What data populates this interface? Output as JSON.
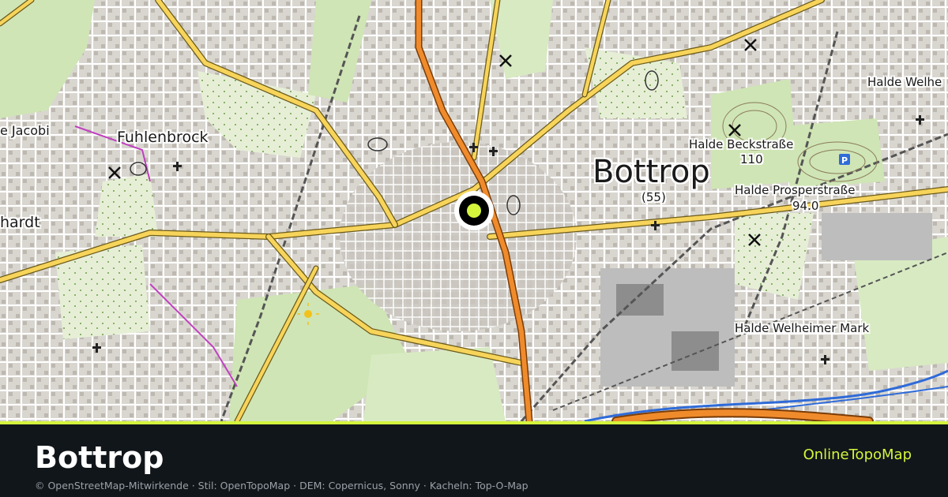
{
  "map": {
    "place_labels": [
      {
        "key": "bottrop",
        "text": "Bottrop"
      },
      {
        "key": "fuhlenbrock",
        "text": "Fuhlenbrock"
      },
      {
        "key": "jacobi",
        "text": "e Jacobi"
      },
      {
        "key": "hardt",
        "text": "hardt"
      },
      {
        "key": "halde_beckstrasse",
        "text": "Halde Beckstraße"
      },
      {
        "key": "beck_elev",
        "text": "110"
      },
      {
        "key": "halde_prosperstrasse",
        "text": "Halde Prosperstraße"
      },
      {
        "key": "prosper_elev",
        "text": "94.0"
      },
      {
        "key": "halde_welheim",
        "text": "Halde Welhe"
      },
      {
        "key": "halde_welheimer_mark",
        "text": "Halde Welheimer Mark"
      },
      {
        "key": "road_55",
        "text": "(55)"
      }
    ],
    "icons": [
      "mine-icon",
      "parking-icon",
      "church-icon",
      "sun-viewpoint-icon",
      "location-pin-icon"
    ]
  },
  "footer": {
    "title": "Bottrop",
    "brand": "OnlineTopoMap",
    "credits": "© OpenStreetMap-Mitwirkende · Stil: OpenTopoMap · DEM: Copernicus, Sonny · Kacheln: Top-O-Map"
  },
  "colors": {
    "accent": "#d4f53c",
    "footer_bg": "#11161b",
    "main_road": "#f5a623",
    "primary_road": "#f7d45a",
    "motorway": "#f08b2c",
    "forest": "#cfe5b5",
    "pin_dot": "#d4f53c"
  }
}
